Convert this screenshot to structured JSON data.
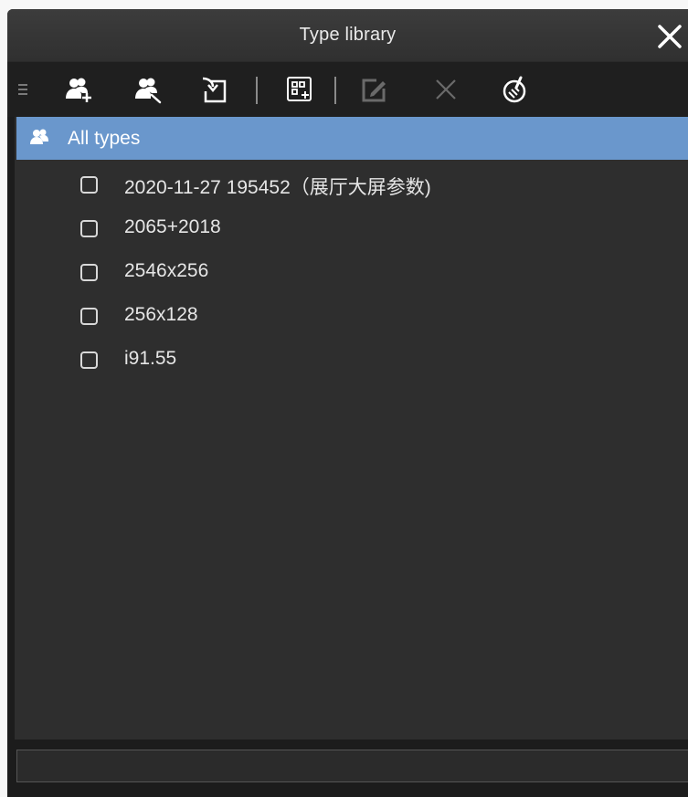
{
  "window": {
    "title": "Type library"
  },
  "toolbar": {
    "tools": [
      {
        "icon": "menu-handle-icon"
      },
      {
        "icon": "add-type-icon"
      },
      {
        "icon": "edit-type-icon"
      },
      {
        "icon": "import-icon"
      },
      {
        "icon": "add-grid-icon"
      },
      {
        "icon": "edit-icon",
        "disabled": true
      },
      {
        "icon": "delete-icon",
        "disabled": true
      },
      {
        "icon": "clean-icon"
      }
    ]
  },
  "tree": {
    "root": {
      "label": "All types",
      "icon": "users-icon",
      "selected": true
    },
    "items": [
      {
        "label": "2020-11-27 195452（展厅大屏参数)",
        "checked": false
      },
      {
        "label": "2065+2018",
        "checked": false
      },
      {
        "label": "2546x256",
        "checked": false
      },
      {
        "label": "256x128",
        "checked": false
      },
      {
        "label": "i91.55",
        "checked": false
      }
    ]
  },
  "colors": {
    "selection": "#6a97cc",
    "panel": "#2e2e2e",
    "window": "#1c1c1c"
  }
}
